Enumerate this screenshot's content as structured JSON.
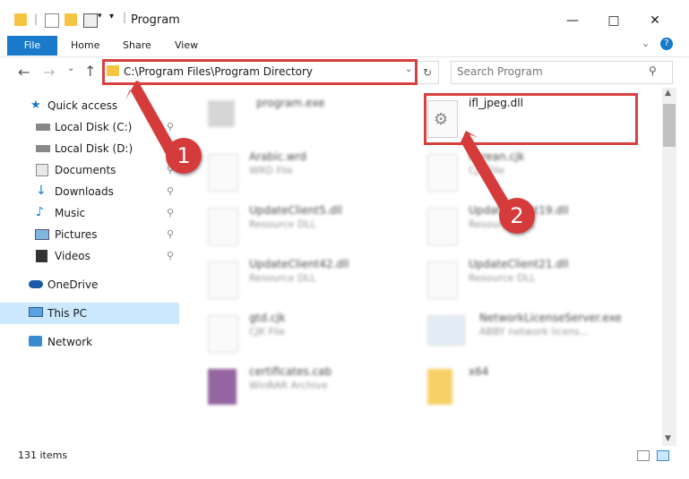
{
  "window": {
    "title": "Program"
  },
  "ribbon": {
    "tabs": [
      "File",
      "Home",
      "Share",
      "View"
    ]
  },
  "address": {
    "path": "C:\\Program Files\\Program Directory"
  },
  "search": {
    "placeholder": "Search Program"
  },
  "sidebar": {
    "items": [
      {
        "label": "Quick access",
        "icon": "star-icon"
      },
      {
        "label": "Local Disk (C:)",
        "icon": "drive-icon"
      },
      {
        "label": "Local Disk (D:)",
        "icon": "drive-icon"
      },
      {
        "label": "Documents",
        "icon": "documents-icon"
      },
      {
        "label": "Downloads",
        "icon": "download-icon"
      },
      {
        "label": "Music",
        "icon": "music-icon"
      },
      {
        "label": "Pictures",
        "icon": "pictures-icon"
      },
      {
        "label": "Videos",
        "icon": "videos-icon"
      },
      {
        "label": "OneDrive",
        "icon": "cloud-icon"
      },
      {
        "label": "This PC",
        "icon": "computer-icon"
      },
      {
        "label": "Network",
        "icon": "network-icon"
      }
    ]
  },
  "files": [
    {
      "name": "program.exe",
      "type": ""
    },
    {
      "name": "ifl_jpeg.dll",
      "type": ""
    },
    {
      "name": "Arabic.wrd",
      "type": "WRD File"
    },
    {
      "name": "Korean.cjk",
      "type": "CJK File"
    },
    {
      "name": "UpdateClient5.dll",
      "type": "Resource DLL"
    },
    {
      "name": "UpdateClient19.dll",
      "type": "Resource DLL"
    },
    {
      "name": "UpdateClient42.dll",
      "type": "Resource DLL"
    },
    {
      "name": "UpdateClient21.dll",
      "type": "Resource DLL"
    },
    {
      "name": "gtd.cjk",
      "type": "CJK File"
    },
    {
      "name": "NetworkLicenseServer.exe",
      "type": "ABBY network licens..."
    },
    {
      "name": "certificates.cab",
      "type": "WinRAR Archive"
    },
    {
      "name": "x64",
      "type": ""
    }
  ],
  "status": {
    "item_count": "131 items"
  },
  "annotations": {
    "badge1": "1",
    "badge2": "2"
  },
  "colors": {
    "accent": "#1979ca",
    "highlight": "#d84040",
    "badge": "#d63b3b",
    "selected": "#cce8ff"
  }
}
